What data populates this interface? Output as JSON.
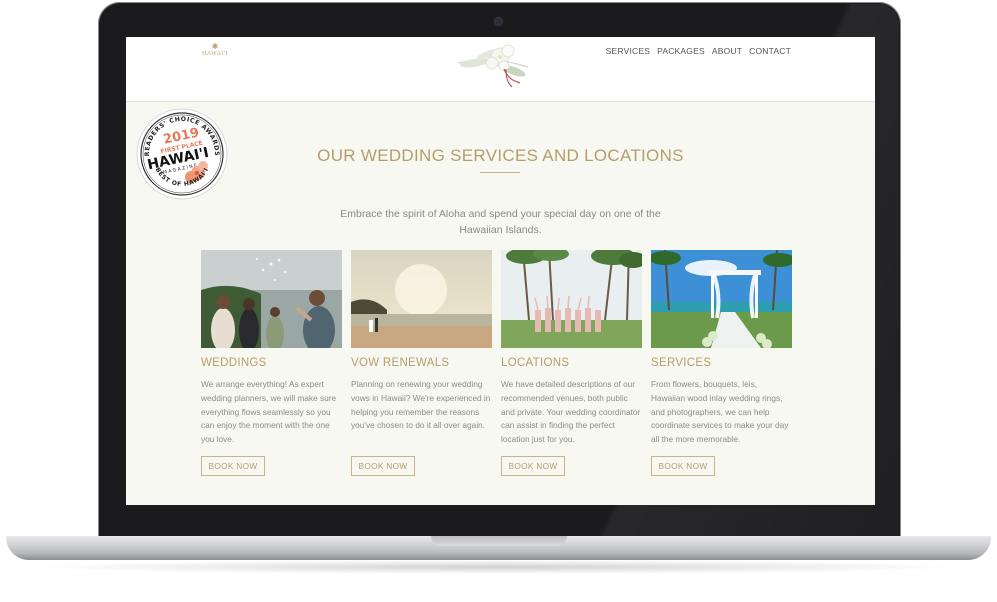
{
  "device": {
    "type": "laptop",
    "bezel_color": "#1b1b1d",
    "body_color": "#d5d6d9"
  },
  "header": {
    "logo_text": "HAWAI'I",
    "nav": [
      "SERVICES",
      "PACKAGES",
      "ABOUT",
      "CONTACT"
    ]
  },
  "badge": {
    "line1": "READERS' CHOICE AWARDS",
    "year": "2019",
    "place": "FIRST PLACE",
    "brand": "HAWAI'I",
    "brand_sub": "MAGAZINE",
    "footer": "BEST OF HAWAI'I"
  },
  "main": {
    "title": "OUR WEDDING SERVICES AND LOCATIONS",
    "intro": "Embrace the spirit of Aloha and spend your special day on one of the Hawaiian Islands.",
    "cards": [
      {
        "title": "WEDDINGS",
        "text": "We arrange everything! As expert wedding planners, we will make sure everything flows seamlessly so you can enjoy the moment with the one you love.",
        "button": "BOOK NOW"
      },
      {
        "title": "VOW RENEWALS",
        "text": "Planning on renewing your wedding vows in Hawaii? We're experienced in helping you remember the reasons you've chosen to do it all over again.",
        "button": "BOOK NOW"
      },
      {
        "title": "LOCATIONS",
        "text": "We have detailed descriptions of our recommended venues, both public and private. Your wedding coordinator can assist in finding the perfect location just for you.",
        "button": "BOOK NOW"
      },
      {
        "title": "SERVICES",
        "text": "From flowers, bouquets, leis, Hawaiian wood inlay wedding rings, and photographers, we can help coordinate services to make your day all the more memorable.",
        "button": "BOOK NOW"
      }
    ]
  },
  "colors": {
    "accent_gold": "#b59d6a",
    "badge_coral": "#e8785a",
    "page_bg": "#f8f8f3"
  }
}
